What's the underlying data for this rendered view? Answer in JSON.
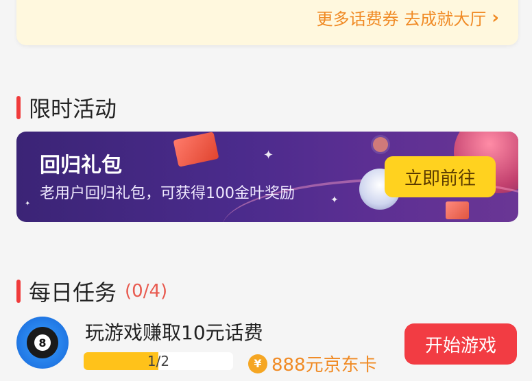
{
  "top_card": {
    "more_link_text": "更多话费券 去成就大厅",
    "chevron_icon": "chevron-right-icon"
  },
  "limited_section": {
    "title": "限时活动"
  },
  "banner": {
    "title": "回归礼包",
    "subtitle": "老用户回归礼包，可获得100金叶奖励",
    "button_label": "立即前往"
  },
  "daily_section": {
    "title": "每日任务",
    "count": "(0/4)"
  },
  "task": {
    "title": "玩游戏赚取10元话费",
    "progress_text": "1/2",
    "progress_fraction": 0.5,
    "reward_text": "888元京东卡",
    "coin_symbol": "¥",
    "avatar_number": "8",
    "button_label": "开始游戏"
  },
  "colors": {
    "accent_red": "#f03b3b",
    "link_orange": "#f08a24",
    "button_yellow": "#ffd21f",
    "progress_yellow": "#ffc21a",
    "start_button_red": "#f23c43"
  }
}
